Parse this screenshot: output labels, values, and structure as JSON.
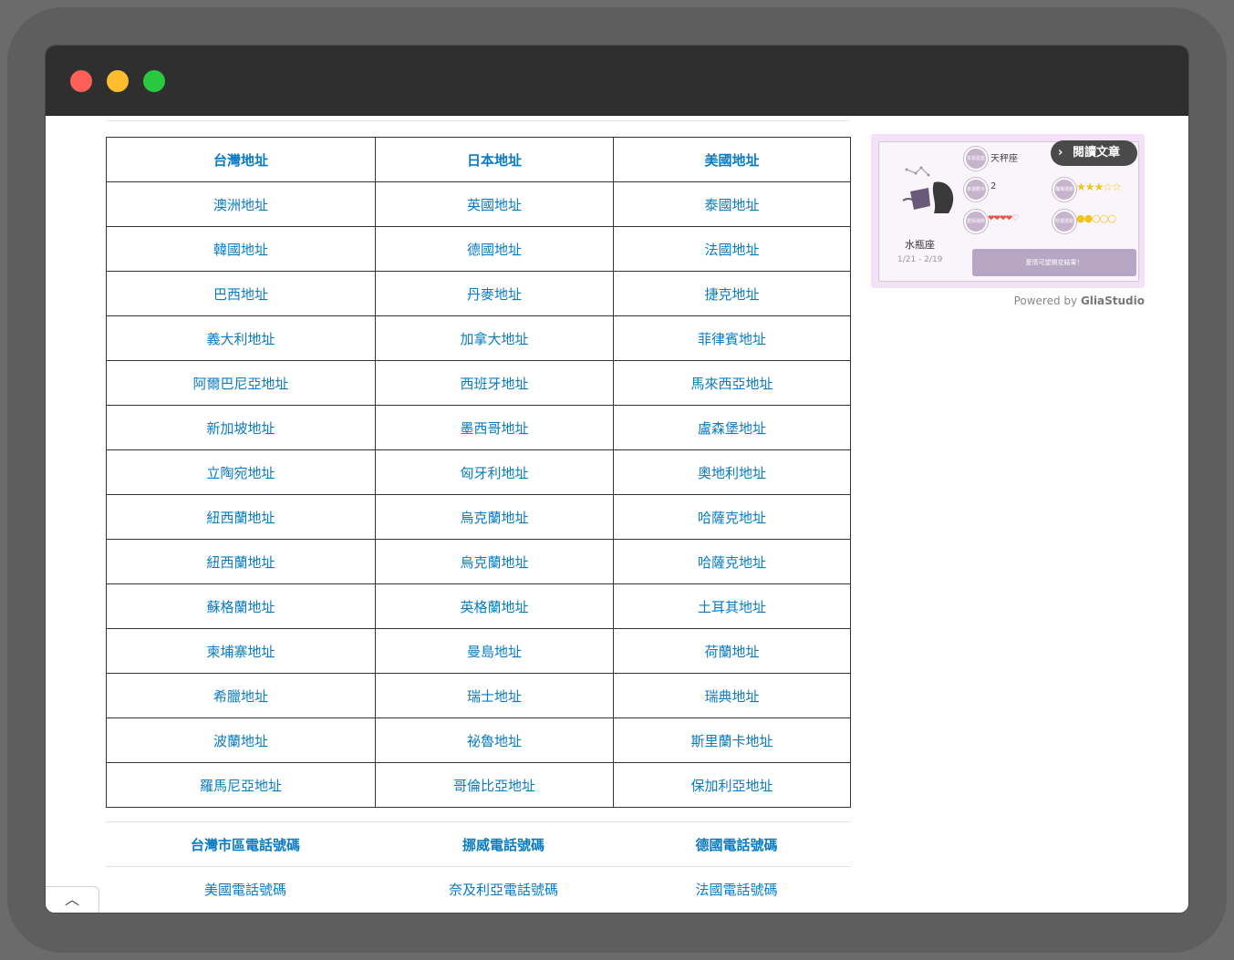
{
  "addresses": {
    "header": [
      "台灣地址",
      "日本地址",
      "美國地址"
    ],
    "rows": [
      [
        "澳洲地址",
        "英國地址",
        "泰國地址"
      ],
      [
        "韓國地址",
        "德國地址",
        "法國地址"
      ],
      [
        "巴西地址",
        "丹麥地址",
        "捷克地址"
      ],
      [
        "義大利地址",
        "加拿大地址",
        "菲律賓地址"
      ],
      [
        "阿爾巴尼亞地址",
        "西班牙地址",
        "馬來西亞地址"
      ],
      [
        "新加坡地址",
        "墨西哥地址",
        "盧森堡地址"
      ],
      [
        "立陶宛地址",
        "匈牙利地址",
        "奧地利地址"
      ],
      [
        "紐西蘭地址",
        "烏克蘭地址",
        "哈薩克地址"
      ],
      [
        "紐西蘭地址",
        "烏克蘭地址",
        "哈薩克地址"
      ],
      [
        "蘇格蘭地址",
        "英格蘭地址",
        "土耳其地址"
      ],
      [
        "柬埔寨地址",
        "曼島地址",
        "荷蘭地址"
      ],
      [
        "希臘地址",
        "瑞士地址",
        "瑞典地址"
      ],
      [
        "波蘭地址",
        "祕魯地址",
        "斯里蘭卡地址"
      ],
      [
        "羅馬尼亞地址",
        "哥倫比亞地址",
        "保加利亞地址"
      ]
    ]
  },
  "phones": {
    "header": [
      "台灣市區電話號碼",
      "挪威電話號碼",
      "德國電話號碼"
    ],
    "rows": [
      [
        "美國電話號碼",
        "奈及利亞電話號碼",
        "法國電話號碼"
      ]
    ]
  },
  "ad": {
    "sign_name": "水瓶座",
    "sign_date": "1/21 - 2/19",
    "match_label": "天秤座",
    "lucky_number": "2",
    "read_button": "閱讀文章",
    "verdict": "愛情可望開花結果！",
    "badge_1": "本週星座",
    "badge_2": "幸運數字",
    "badge_3": "愛情運勢",
    "badge_4": "職場運勢",
    "badge_5": "財運運勢",
    "hearts": "❤❤❤❤♡",
    "stars": "★★★☆☆",
    "coins": "●●○○○",
    "powered_prefix": "Powered by",
    "powered_brand": "GliaStudio"
  },
  "scroll_top_glyph": "︿",
  "colors": {
    "link": "#0a7bc1",
    "titlebar": "#2f2f2f"
  }
}
